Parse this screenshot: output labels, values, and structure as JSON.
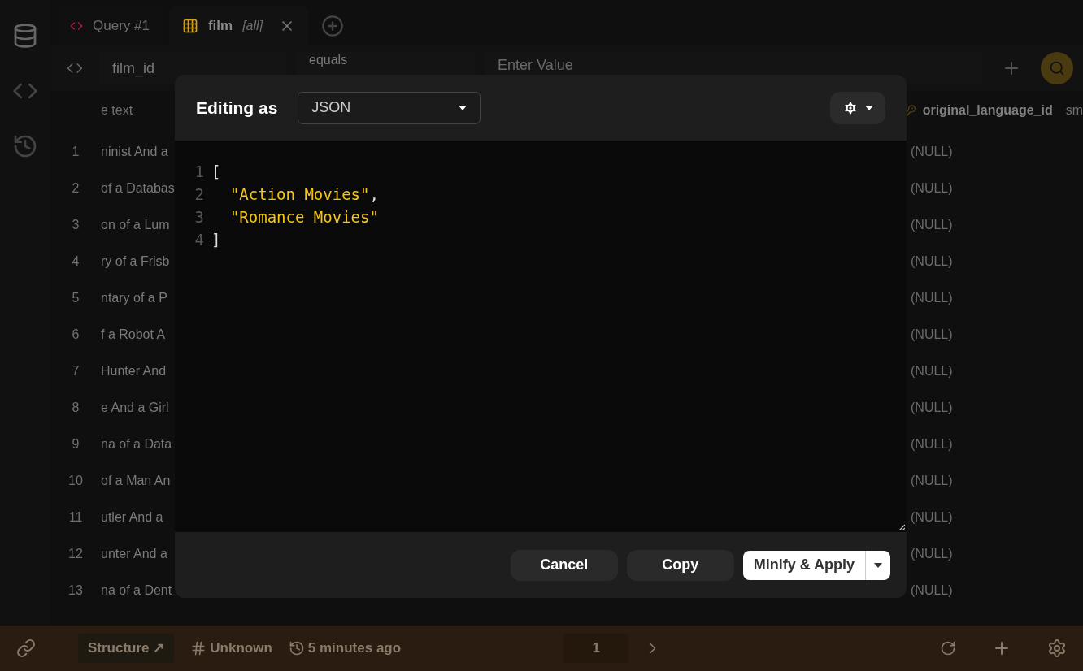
{
  "tabs": [
    {
      "kind": "query",
      "label": "Query #1",
      "selected": false
    },
    {
      "kind": "table",
      "label": "film",
      "tag": "[all]",
      "selected": true
    }
  ],
  "filter": {
    "column": "film_id",
    "operator": "equals",
    "placeholder": "Enter Value"
  },
  "table": {
    "header_left": "e text",
    "header_right": "original_language_id",
    "header_cut": "sm",
    "rows": [
      {
        "number": "1",
        "text": "ninist And a",
        "right": "(NULL)"
      },
      {
        "number": "2",
        "text": "of a Databas",
        "right": "(NULL)"
      },
      {
        "number": "3",
        "text": "on of a Lum",
        "right": "(NULL)"
      },
      {
        "number": "4",
        "text": "ry of a Frisb",
        "right": "(NULL)"
      },
      {
        "number": "5",
        "text": "ntary of a P",
        "right": "(NULL)"
      },
      {
        "number": "6",
        "text": "f a Robot A",
        "right": "(NULL)"
      },
      {
        "number": "7",
        "text": "Hunter And",
        "right": "(NULL)"
      },
      {
        "number": "8",
        "text": "e And a Girl",
        "right": "(NULL)"
      },
      {
        "number": "9",
        "text": "na of a Data",
        "right": "(NULL)"
      },
      {
        "number": "10",
        "text": "of a Man An",
        "right": "(NULL)"
      },
      {
        "number": "11",
        "text": "utler And a",
        "right": "(NULL)"
      },
      {
        "number": "12",
        "text": "unter And a",
        "right": "(NULL)"
      },
      {
        "number": "13",
        "text": "na of a Dent",
        "right": "(NULL)"
      }
    ]
  },
  "status_bar": {
    "structure": "Structure ↗",
    "count": "Unknown",
    "updated": "5 minutes ago",
    "page": "1"
  },
  "modal": {
    "title": "Editing as",
    "format": "JSON",
    "lines": [
      {
        "number": "1",
        "tokens": [
          {
            "kind": "punct",
            "text": "["
          }
        ]
      },
      {
        "number": "2",
        "tokens": [
          {
            "kind": "string",
            "text": "  \"Action Movies\""
          },
          {
            "kind": "punct",
            "text": ","
          }
        ]
      },
      {
        "number": "3",
        "tokens": [
          {
            "kind": "string",
            "text": "  \"Romance Movies\""
          }
        ]
      },
      {
        "number": "4",
        "tokens": [
          {
            "kind": "punct",
            "text": "]"
          }
        ]
      }
    ],
    "buttons": [
      {
        "kind": "secondary",
        "label": "Cancel"
      },
      {
        "kind": "secondary",
        "label": "Copy"
      },
      {
        "kind": "primary",
        "label": "Minify & Apply"
      }
    ]
  }
}
